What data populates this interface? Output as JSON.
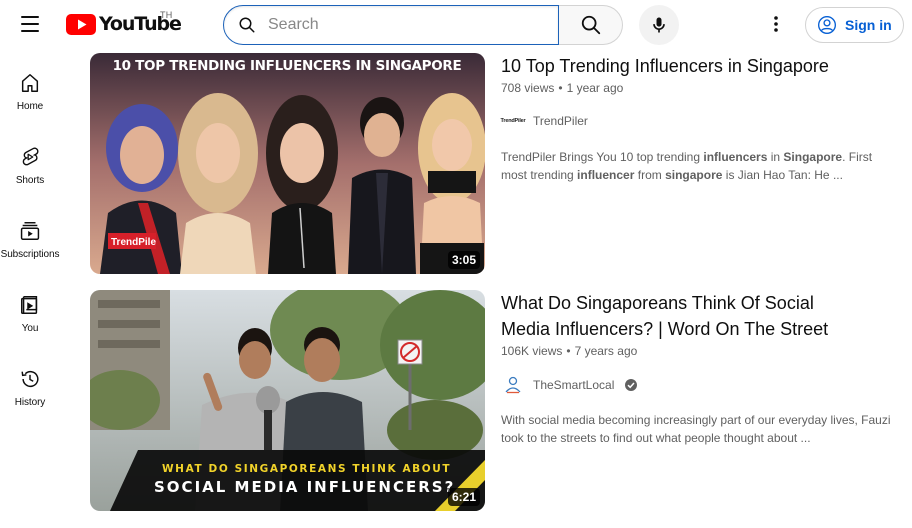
{
  "header": {
    "logo_text": "YouTube",
    "country_code": "TH",
    "search_placeholder": "Search",
    "signin_label": "Sign in"
  },
  "sidebar": {
    "items": [
      {
        "label": "Home",
        "icon": "home-icon"
      },
      {
        "label": "Shorts",
        "icon": "shorts-icon"
      },
      {
        "label": "Subscriptions",
        "icon": "subscriptions-icon"
      },
      {
        "label": "You",
        "icon": "you-icon"
      },
      {
        "label": "History",
        "icon": "history-icon"
      }
    ]
  },
  "results": [
    {
      "title": "10 Top Trending Influencers in Singapore",
      "views": "708 views",
      "age": "1 year ago",
      "channel": "TrendPiler",
      "avatar_text": "TrendPiler",
      "verified": false,
      "duration": "3:05",
      "thumb_caption": "10 TOP TRENDING INFLUENCERS IN SINGAPORE",
      "thumb_brand": "TrendPile",
      "desc": [
        {
          "t": "TrendPiler Brings You 10 top trending ",
          "b": false
        },
        {
          "t": "influencers",
          "b": true
        },
        {
          "t": " in ",
          "b": false
        },
        {
          "t": "Singapore",
          "b": true
        },
        {
          "t": ". First most trending ",
          "b": false
        },
        {
          "t": "influencer",
          "b": true
        },
        {
          "t": " from ",
          "b": false
        },
        {
          "t": "singapore",
          "b": true
        },
        {
          "t": " is Jian Hao Tan: He ...",
          "b": false
        }
      ]
    },
    {
      "title": "What Do Singaporeans Think Of Social Media Influencers? | Word On The Street",
      "views": "106K views",
      "age": "7 years ago",
      "channel": "TheSmartLocal",
      "avatar_text": "",
      "verified": true,
      "duration": "6:21",
      "thumb_caption_1": "WHAT DO SINGAPOREANS THINK ABOUT",
      "thumb_caption_2": "SOCIAL MEDIA INFLUENCERS?",
      "desc": [
        {
          "t": "With social media becoming increasingly part of our everyday lives, Fauzi took to the streets to find out what people thought about ...",
          "b": false
        }
      ]
    }
  ],
  "colors": {
    "brand_red": "#ff0000",
    "link_blue": "#065fd4",
    "meta_gray": "#606060"
  }
}
